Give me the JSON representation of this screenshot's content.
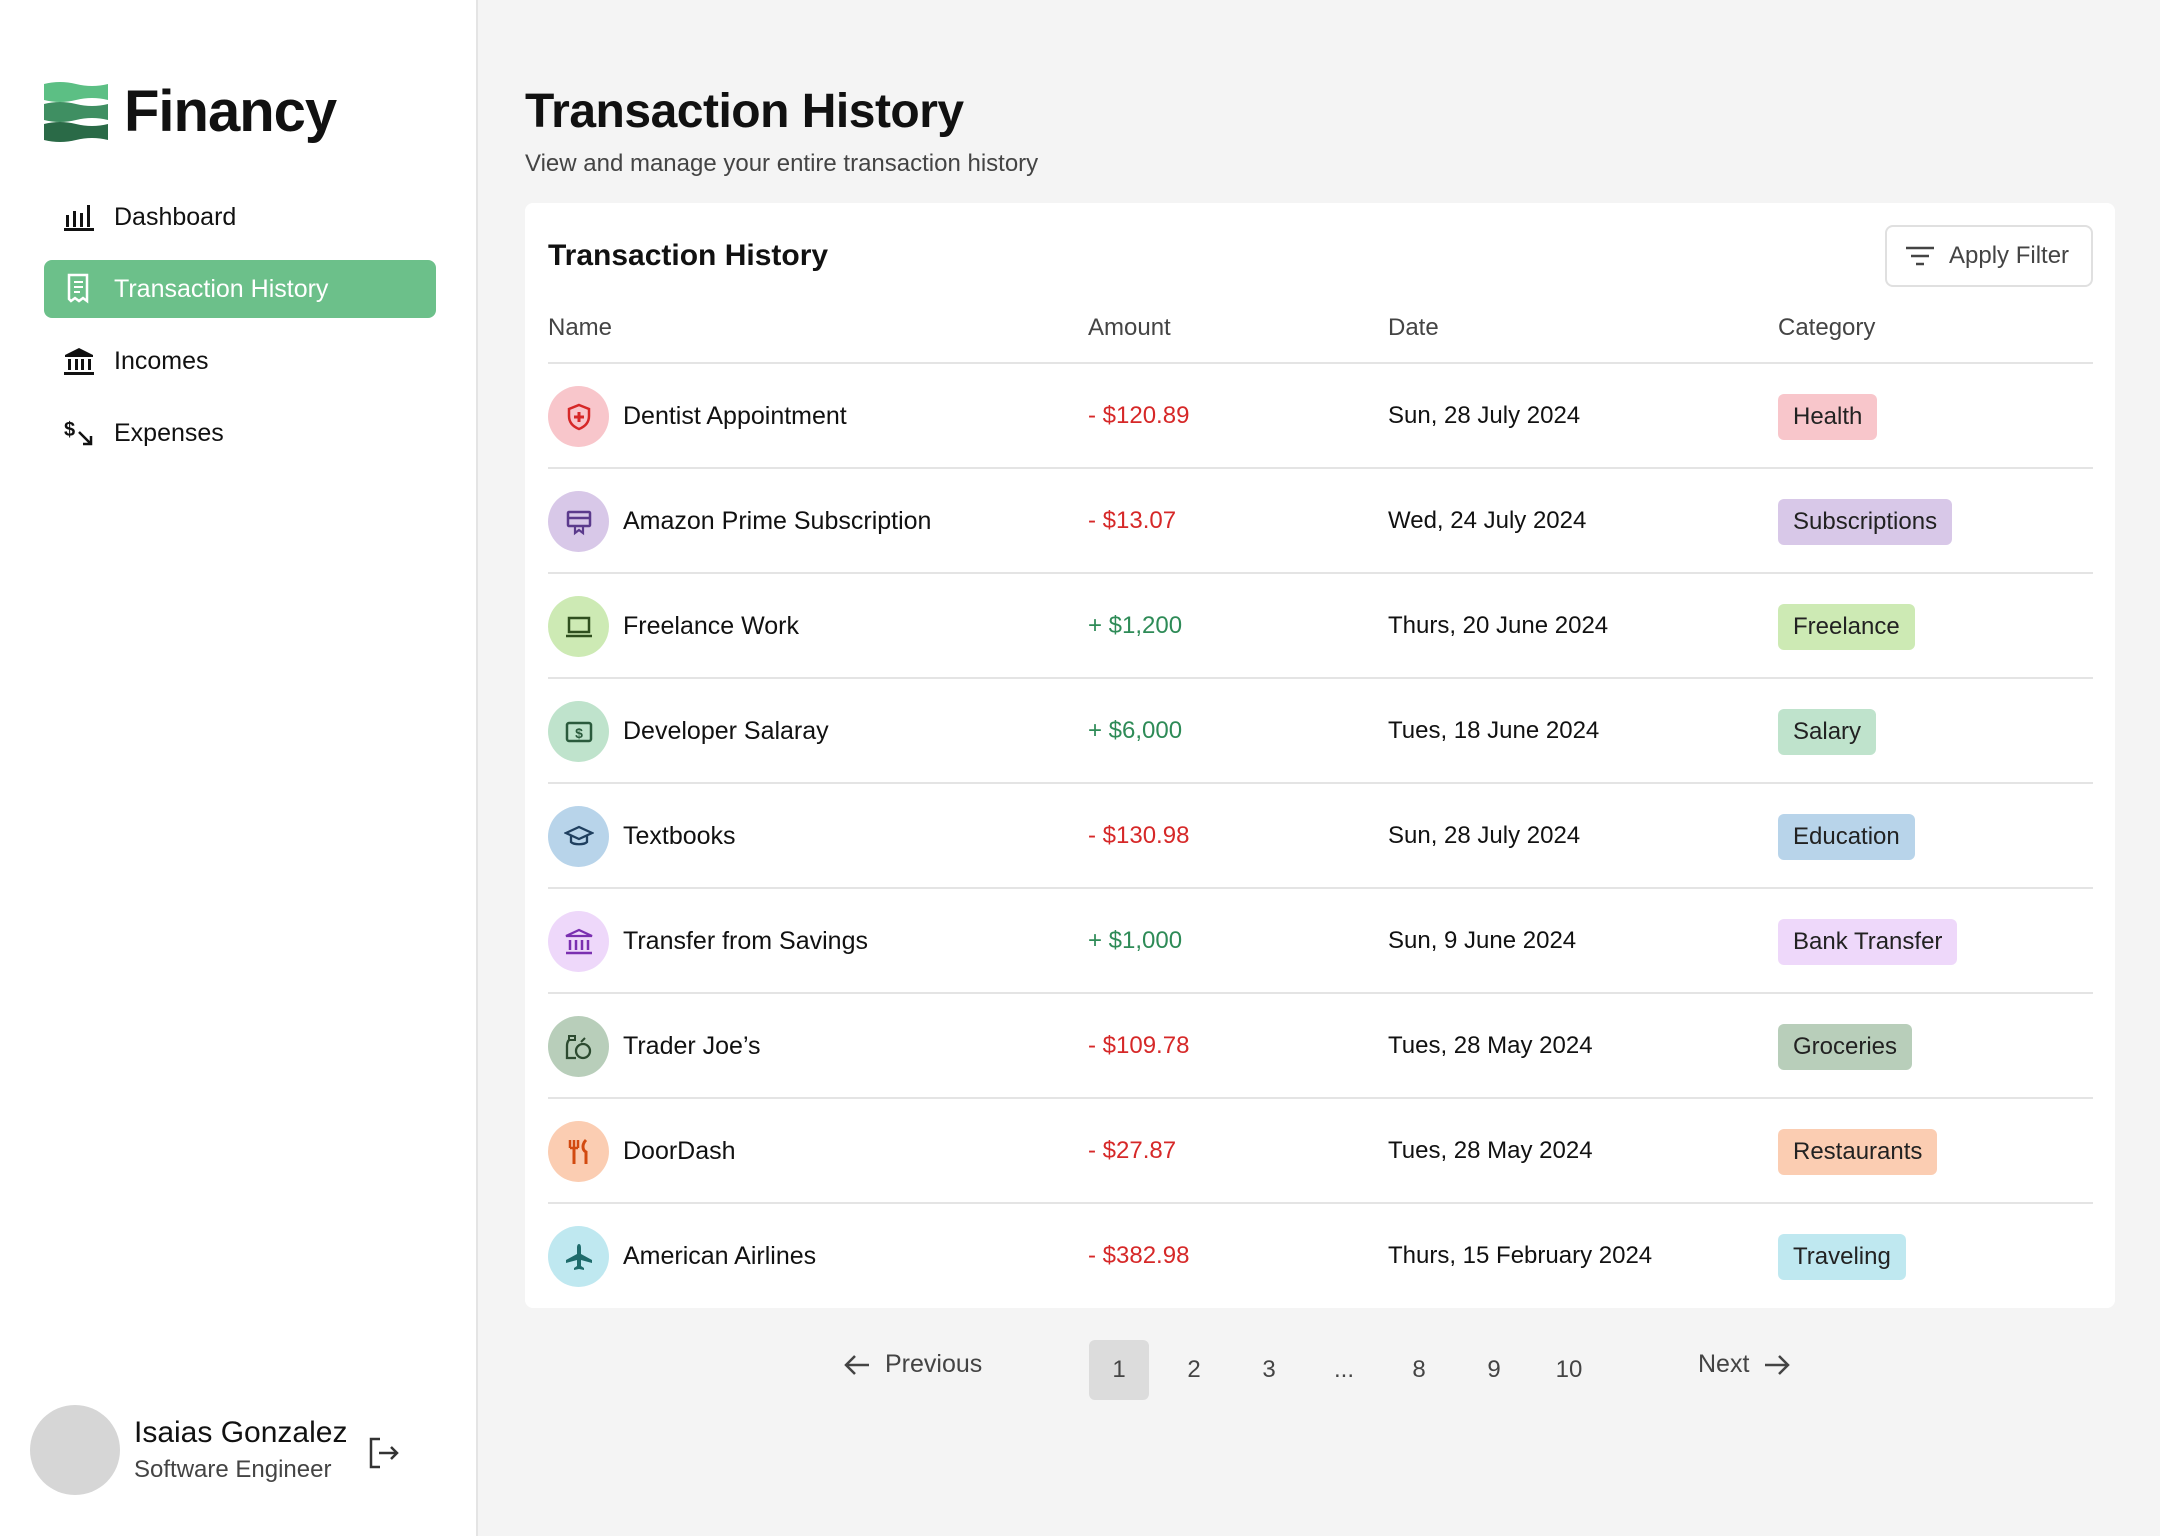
{
  "brand": {
    "name": "Financy"
  },
  "nav": [
    {
      "label": "Dashboard",
      "icon": "bar-chart-icon"
    },
    {
      "label": "Transaction History",
      "icon": "receipt-icon",
      "active": true
    },
    {
      "label": "Incomes",
      "icon": "bank-icon"
    },
    {
      "label": "Expenses",
      "icon": "expense-arrow-icon"
    }
  ],
  "user": {
    "name": "Isaias Gonzalez",
    "role": "Software Engineer"
  },
  "page": {
    "title": "Transaction History",
    "subtitle": "View and manage your entire transaction history"
  },
  "card": {
    "title": "Transaction History",
    "filter_label": "Apply Filter"
  },
  "columns": {
    "name": "Name",
    "amount": "Amount",
    "date": "Date",
    "category": "Category"
  },
  "transactions": [
    {
      "name": "Dentist Appointment",
      "amount": "- $120.89",
      "type": "debit",
      "date": "Sun, 28 July 2024",
      "category": "Health",
      "icon": "medical-shield-icon",
      "icon_bg": "#f8c6cb",
      "icon_color": "#d62828",
      "badge_bg": "#f8c6cb"
    },
    {
      "name": "Amazon Prime Subscription",
      "amount": "- $13.07",
      "type": "debit",
      "date": "Wed, 24 July 2024",
      "category": "Subscriptions",
      "icon": "card-icon",
      "icon_bg": "#d8c8e8",
      "icon_color": "#5b3a8c",
      "badge_bg": "#d8c8e8"
    },
    {
      "name": "Freelance Work",
      "amount": "+ $1,200",
      "type": "credit",
      "date": "Thurs, 20 June 2024",
      "category": "Freelance",
      "icon": "laptop-icon",
      "icon_bg": "#cdeab4",
      "icon_color": "#2f4f1f",
      "badge_bg": "#cdeab4"
    },
    {
      "name": "Developer Salaray",
      "amount": "+ $6,000",
      "type": "credit",
      "date": "Tues, 18 June 2024",
      "category": "Salary",
      "icon": "money-icon",
      "icon_bg": "#bfe3cc",
      "icon_color": "#2a5a3c",
      "badge_bg": "#bfe3cc"
    },
    {
      "name": "Textbooks",
      "amount": "- $130.98",
      "type": "debit",
      "date": "Sun, 28 July 2024",
      "category": "Education",
      "icon": "graduation-cap-icon",
      "icon_bg": "#b8d4ea",
      "icon_color": "#1f3f5f",
      "badge_bg": "#b8d4ea"
    },
    {
      "name": "Transfer from Savings",
      "amount": "+ $1,000",
      "type": "credit",
      "date": "Sun, 9 June 2024",
      "category": "Bank Transfer",
      "icon": "bank-icon",
      "icon_bg": "#eed8fa",
      "icon_color": "#7a2fb0",
      "badge_bg": "#eed8fa"
    },
    {
      "name": "Trader Joe’s",
      "amount": "- $109.78",
      "type": "debit",
      "date": "Tues, 28 May 2024",
      "category": "Groceries",
      "icon": "groceries-icon",
      "icon_bg": "#b8ceba",
      "icon_color": "#2c4a30",
      "badge_bg": "#b8ceba"
    },
    {
      "name": "DoorDash",
      "amount": "- $27.87",
      "type": "debit",
      "date": "Tues, 28 May 2024",
      "category": "Restaurants",
      "icon": "utensils-icon",
      "icon_bg": "#fbcdb2",
      "icon_color": "#d24a10",
      "badge_bg": "#fbcdb2"
    },
    {
      "name": "American Airlines",
      "amount": "- $382.98",
      "type": "debit",
      "date": "Thurs, 15 February 2024",
      "category": "Traveling",
      "icon": "airplane-icon",
      "icon_bg": "#bfe8f0",
      "icon_color": "#1e6b6b",
      "badge_bg": "#bfe8f0"
    }
  ],
  "pagination": {
    "previous_label": "Previous",
    "next_label": "Next",
    "pages": [
      "1",
      "2",
      "3",
      "...",
      "8",
      "9",
      "10"
    ],
    "current": "1"
  },
  "colors": {
    "accent": "#6cc08a",
    "debit": "#d62828",
    "credit": "#2e8b57"
  }
}
